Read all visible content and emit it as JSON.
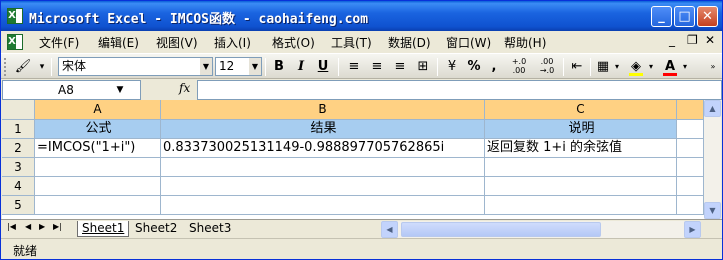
{
  "window": {
    "title": "Microsoft Excel - IMCOS函数 - caohaifeng.com",
    "minimize": "_",
    "maximize": "□",
    "close": "✕"
  },
  "menu": {
    "items": [
      {
        "label": "文件(F)"
      },
      {
        "label": "编辑(E)"
      },
      {
        "label": "视图(V)"
      },
      {
        "label": "插入(I)"
      },
      {
        "label": "格式(O)"
      },
      {
        "label": "工具(T)"
      },
      {
        "label": "数据(D)"
      },
      {
        "label": "窗口(W)"
      },
      {
        "label": "帮助(H)"
      }
    ],
    "mdi_minimize": "_",
    "mdi_restore": "❐",
    "mdi_close": "✕"
  },
  "toolbar": {
    "font_name": "宋体",
    "font_size": "12",
    "bold": "B",
    "italic": "I",
    "underline": "U",
    "percent": "%",
    "comma": ",",
    "inc_decimal": "+.0\n.00",
    "dec_decimal": ".00\n→.0",
    "fill_color": "#ffff00",
    "font_color": "#ff0000"
  },
  "formula_bar": {
    "name_box": "A8",
    "fx": "fx",
    "content": ""
  },
  "grid": {
    "columns": [
      "A",
      "B",
      "C"
    ],
    "rows": [
      "1",
      "2",
      "3",
      "4",
      "5"
    ],
    "header_row": [
      "公式",
      "结果",
      "说明"
    ],
    "data_row": [
      "=IMCOS(\"1+i\")",
      "0.833730025131149-0.988897705762865i",
      "返回复数 1+i 的余弦值"
    ]
  },
  "sheets": {
    "tabs": [
      "Sheet1",
      "Sheet2",
      "Sheet3"
    ],
    "active": "Sheet1"
  },
  "status": {
    "text": "就绪"
  },
  "colors": {
    "header_fill": "#a7cdf0",
    "col_header_active": "#ffd183",
    "title_bar": "#0a5fd8"
  }
}
